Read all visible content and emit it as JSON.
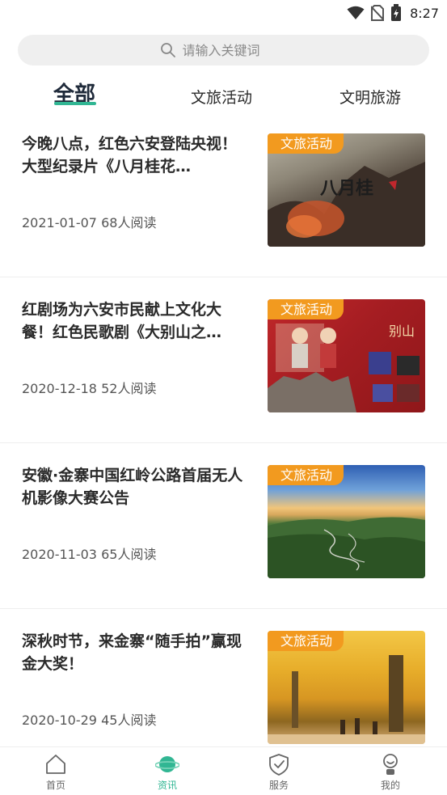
{
  "status_bar": {
    "time": "8:27"
  },
  "search": {
    "placeholder": "请输入关键词"
  },
  "tabs": [
    {
      "label": "全部",
      "active": true
    },
    {
      "label": "文旅活动",
      "active": false
    },
    {
      "label": "文明旅游",
      "active": false
    }
  ],
  "news": [
    {
      "title": "今晚八点，红色六安登陆央视！大型纪录片《八月桂花…",
      "date": "2021-01-07",
      "reads": "68人阅读",
      "tag": "文旅活动"
    },
    {
      "title": "红剧场为六安市民献上文化大餐！红色民歌剧《大别山之…",
      "date": "2020-12-18",
      "reads": "52人阅读",
      "tag": "文旅活动"
    },
    {
      "title": "安徽·金寨中国红岭公路首届无人机影像大赛公告",
      "date": "2020-11-03",
      "reads": "65人阅读",
      "tag": "文旅活动"
    },
    {
      "title": "深秋时节，来金寨“随手拍”赢现金大奖！",
      "date": "2020-10-29",
      "reads": "45人阅读",
      "tag": "文旅活动"
    }
  ],
  "bottom_nav": [
    {
      "label": "首页",
      "icon": "home-icon",
      "active": false
    },
    {
      "label": "资讯",
      "icon": "planet-icon",
      "active": true
    },
    {
      "label": "服务",
      "icon": "shield-check-icon",
      "active": false
    },
    {
      "label": "我的",
      "icon": "user-icon",
      "active": false
    }
  ],
  "colors": {
    "accent": "#31b693",
    "tag": "#f29a1f"
  }
}
